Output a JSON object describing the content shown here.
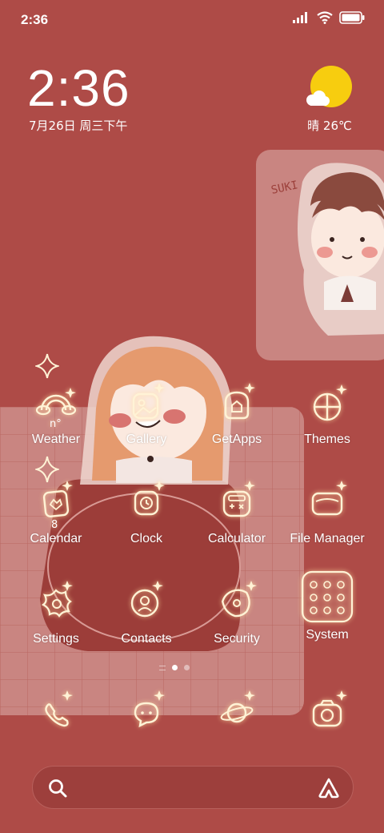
{
  "status_bar": {
    "time": "2:36"
  },
  "clock_widget": {
    "time": "2:36",
    "date": "7月26日 周三下午"
  },
  "weather_widget": {
    "condition": "晴",
    "temperature": "26℃",
    "icon": "sun-cloud-icon"
  },
  "photo_widget": {
    "caption": "SUKI"
  },
  "apps": [
    {
      "label": "Weather",
      "icon": "rainbow-icon",
      "icon_text": "n°"
    },
    {
      "label": "Gallery",
      "icon": "gallery-icon"
    },
    {
      "label": "GetApps",
      "icon": "bag-icon"
    },
    {
      "label": "Themes",
      "icon": "themes-icon"
    },
    {
      "label": "Calendar",
      "icon": "calendar-icon",
      "icon_text": "8"
    },
    {
      "label": "Clock",
      "icon": "alarm-clock-icon"
    },
    {
      "label": "Calculator",
      "icon": "calculator-icon"
    },
    {
      "label": "File Manager",
      "icon": "folder-icon"
    },
    {
      "label": "Settings",
      "icon": "gear-icon"
    },
    {
      "label": "Contacts",
      "icon": "contacts-icon"
    },
    {
      "label": "Security",
      "icon": "shield-icon"
    },
    {
      "label": "System",
      "icon": "folder-grid-icon"
    }
  ],
  "dock": [
    {
      "icon": "phone-icon"
    },
    {
      "icon": "messages-icon"
    },
    {
      "icon": "browser-planet-icon"
    },
    {
      "icon": "camera-icon"
    }
  ],
  "colors": {
    "background": "#ae4b47",
    "widget": "#c98581",
    "icon_line": "#fff3d6",
    "sun": "#f7cd0f"
  }
}
